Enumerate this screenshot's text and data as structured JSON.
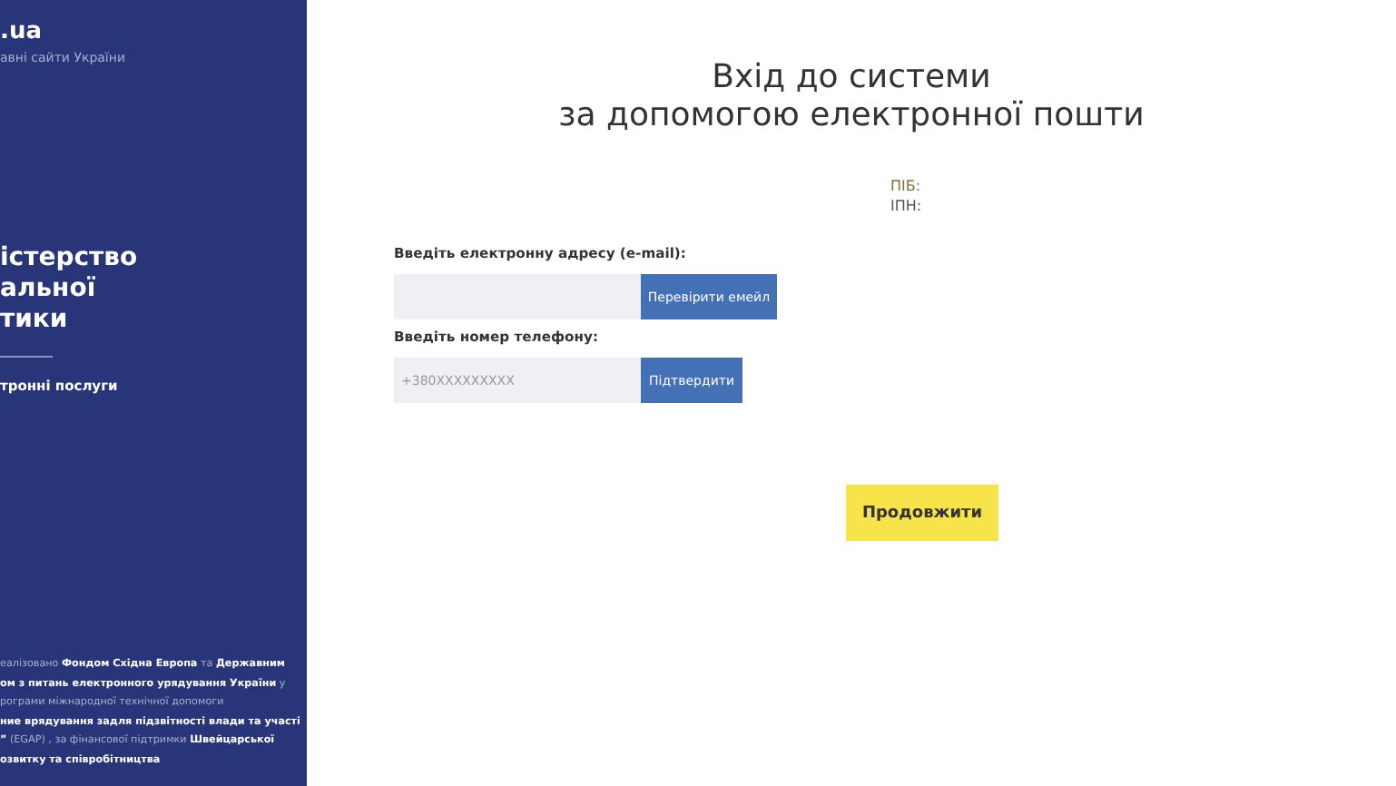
{
  "sidebar": {
    "logo": ".ua",
    "tagline": "авні сайти України",
    "ministry_lines": [
      "істерство",
      "альної",
      "тики"
    ],
    "services_label": "тронні послуги",
    "footer_lines": [
      "еалізовано **Фондом Східна Европа** та **Державним**",
      "**ом з питань електронного урядування України** у",
      "рограми міжнародної технічної допомоги",
      "**ние врядування задля підзвітності влади та участі**",
      "**”** (EGAP) , за фінансової підтримки **Швейцарської**",
      "**озвитку та співробітництва**"
    ]
  },
  "main": {
    "title_lines": [
      "Вхід до системи",
      "за допомогою електронної пошти"
    ],
    "person_fields": [
      "ПІБ:",
      "ІПН:"
    ],
    "email": {
      "label": "Введіть електронну адресу (e-mail):",
      "button": "Перевірити емейл"
    },
    "phone": {
      "label": "Введіть номер телефону:",
      "placeholder": "+380XXXXXXXXX",
      "button": "Підтвердити"
    },
    "continue_button": "Продовжити"
  }
}
